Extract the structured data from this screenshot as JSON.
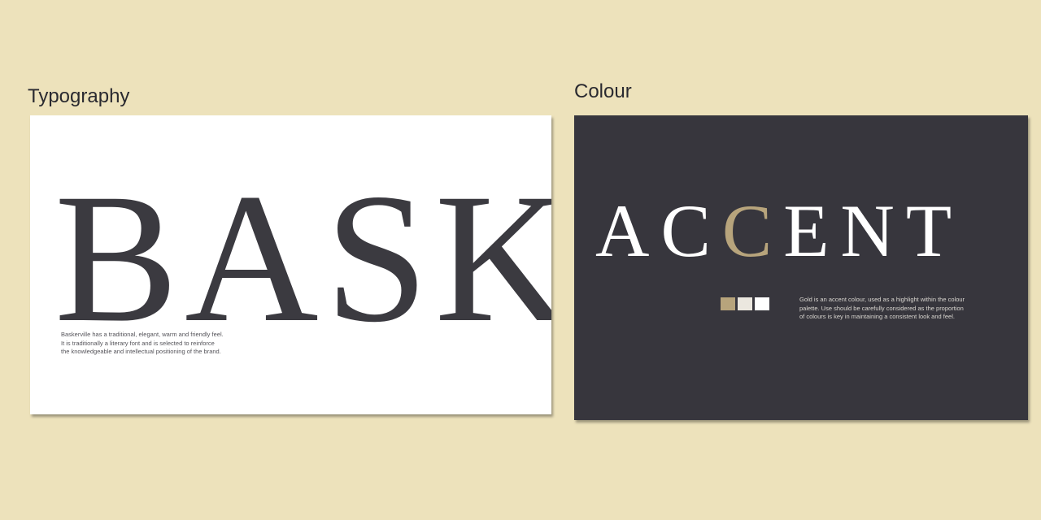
{
  "typography": {
    "heading": "Typography",
    "sample_word": "BASK",
    "description_lines": [
      "Baskerville has a traditional, elegant, warm and friendly feel.",
      "It is traditionally a literary font and is selected to reinforce",
      "the knowledgeable and intellectual positioning of the brand."
    ]
  },
  "colour": {
    "heading": "Colour",
    "word_before": "AC",
    "word_highlight": "C",
    "word_after": "ENT",
    "swatches": [
      "#b7a47c",
      "#ebe7df",
      "#ffffff"
    ],
    "description_lines": [
      "Gold is an accent colour, used as a highlight within the colour",
      "palette. Use should be carefully considered as the proportion",
      "of colours is key in maintaining a consistent look and feel."
    ]
  },
  "colors": {
    "page_background": "#ede2bb",
    "dark_card": "#37363d",
    "gold_accent": "#b7a47c",
    "type_dark": "#3b3a40"
  }
}
